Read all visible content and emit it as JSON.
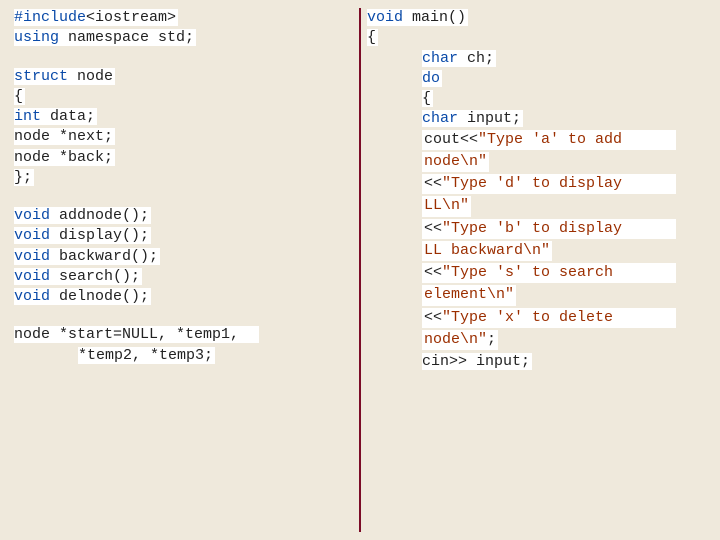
{
  "left": {
    "l1a": "#include",
    "l1b": "<iostream>",
    "l2a": "using",
    "l2b": " namespace ",
    "l2c": "std;",
    "l3a": "struct",
    "l3b": " node",
    "l4": "{",
    "l5a": "int",
    "l5b": " data;",
    "l6b": " *next;",
    "l6a": "node",
    "l7a": "node",
    "l7b": " *back;",
    "l8": "};",
    "l9a": "void",
    "l9b": " addnode();",
    "l10a": "void",
    "l10b": " display();",
    "l11a": "void",
    "l11b": " backward();",
    "l12a": "void",
    "l12b": " search();",
    "l13a": "void",
    "l13b": " delnode();",
    "l14a": "node",
    "l14b": " *start=NULL, *temp1,",
    "l15": "*temp2, *temp3;"
  },
  "right": {
    "r1a": "void",
    "r1b": " main()",
    "r2": "{",
    "r3a": "char",
    "r3b": " ch;",
    "r4": "do",
    "r5": "{",
    "r6a": "char",
    "r6b": " input;",
    "r7a": "cout<<",
    "r7b": "\"Type 'a' to add ",
    "r7c": "node\\n\"",
    "r8a": "<<",
    "r8b": "\"Type 'd' to display ",
    "r8c": "LL\\n\"",
    "r9a": "<<",
    "r9b": "\"Type 'b' to display ",
    "r9c": "LL backward\\n\"",
    "r10a": "<<",
    "r10b": "\"Type 's' to search ",
    "r10c": "element\\n\"",
    "r11a": "<<",
    "r11b": "\"Type 'x' to delete ",
    "r11c": "node\\n\"",
    "r11d": ";",
    "r12a": "cin",
    "r12b": ">> input;"
  }
}
